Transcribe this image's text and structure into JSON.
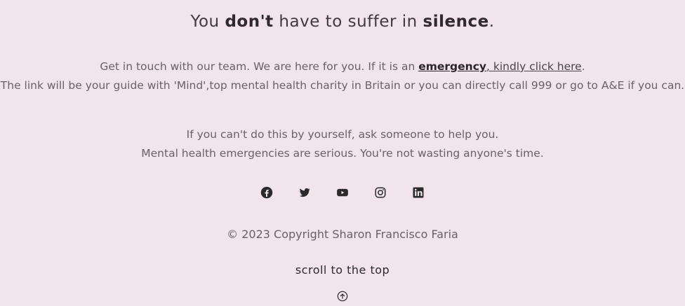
{
  "headline": {
    "part1": "You ",
    "bold1": "don't",
    "part2": " have to suffer in ",
    "bold2": "silence",
    "part3": "."
  },
  "intro": {
    "before_link": "Get in touch with our team. We are here for you. If it is an ",
    "emergency_link": "emergency",
    "kindly_link": ", kindly click here",
    "after_link": ".",
    "line2": "The link will be your guide with 'Mind',top mental health charity in Britain or you can directly call 999 or go to A&E if you can."
  },
  "support": {
    "line1": "If you can't do this by yourself, ask someone to help you.",
    "line2": "Mental health emergencies are serious. You're not wasting anyone's time."
  },
  "social_icons": [
    "facebook-icon",
    "twitter-icon",
    "youtube-icon",
    "instagram-icon",
    "linkedin-icon"
  ],
  "footer": {
    "copyright": "© 2023 Copyright Sharon Francisco Faria",
    "scroll_label": "scroll to the top",
    "scroll_icon": "arrow-up-circle-icon"
  },
  "colors": {
    "background": "#f1e4ea",
    "text": "#5a5357",
    "icon": "#2a2a2a"
  }
}
